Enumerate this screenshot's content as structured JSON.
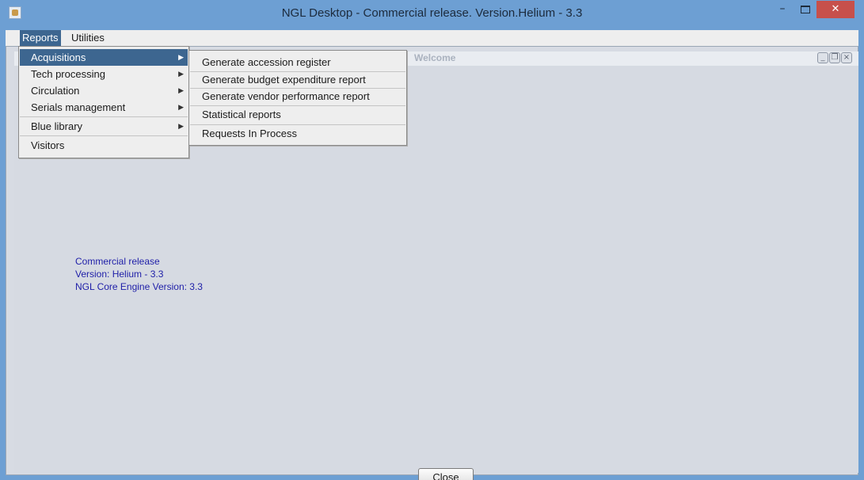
{
  "window": {
    "title": "NGL Desktop - Commercial release. Version.Helium - 3.3",
    "minimize_glyph": "–",
    "close_glyph": "✕"
  },
  "menubar": {
    "items": [
      {
        "label": "Reports"
      },
      {
        "label": "Utilities"
      }
    ]
  },
  "reports_menu": {
    "items": [
      {
        "label": "Acquisitions",
        "arrow": "▶"
      },
      {
        "label": "Tech processing",
        "arrow": "▶"
      },
      {
        "label": "Circulation",
        "arrow": "▶"
      },
      {
        "label": "Serials management",
        "arrow": "▶"
      },
      {
        "label": "Blue library",
        "arrow": "▶"
      },
      {
        "label": "Visitors"
      }
    ]
  },
  "acquisitions_menu": {
    "items": [
      {
        "label": "Generate accession register"
      },
      {
        "label": "Generate budget expenditure report"
      },
      {
        "label": "Generate vendor performance report"
      },
      {
        "label": "Statistical reports"
      },
      {
        "label": "Requests In Process"
      }
    ]
  },
  "internal_frame": {
    "title": "Welcome",
    "info": [
      "Commercial release",
      "Version: Helium - 3.3",
      "NGL Core Engine Version: 3.3"
    ],
    "close_button": "Close"
  },
  "colors": {
    "title_bar": "#6d9fd3",
    "menu_highlight": "#3d6690",
    "info_text": "#1e1ea8",
    "window_close": "#c7504b"
  },
  "icons": [
    "app-icon",
    "minimize-icon",
    "maximize-icon",
    "close-icon",
    "submenu-arrow-icon",
    "frame-minimize-icon",
    "frame-restore-icon",
    "frame-close-icon"
  ]
}
